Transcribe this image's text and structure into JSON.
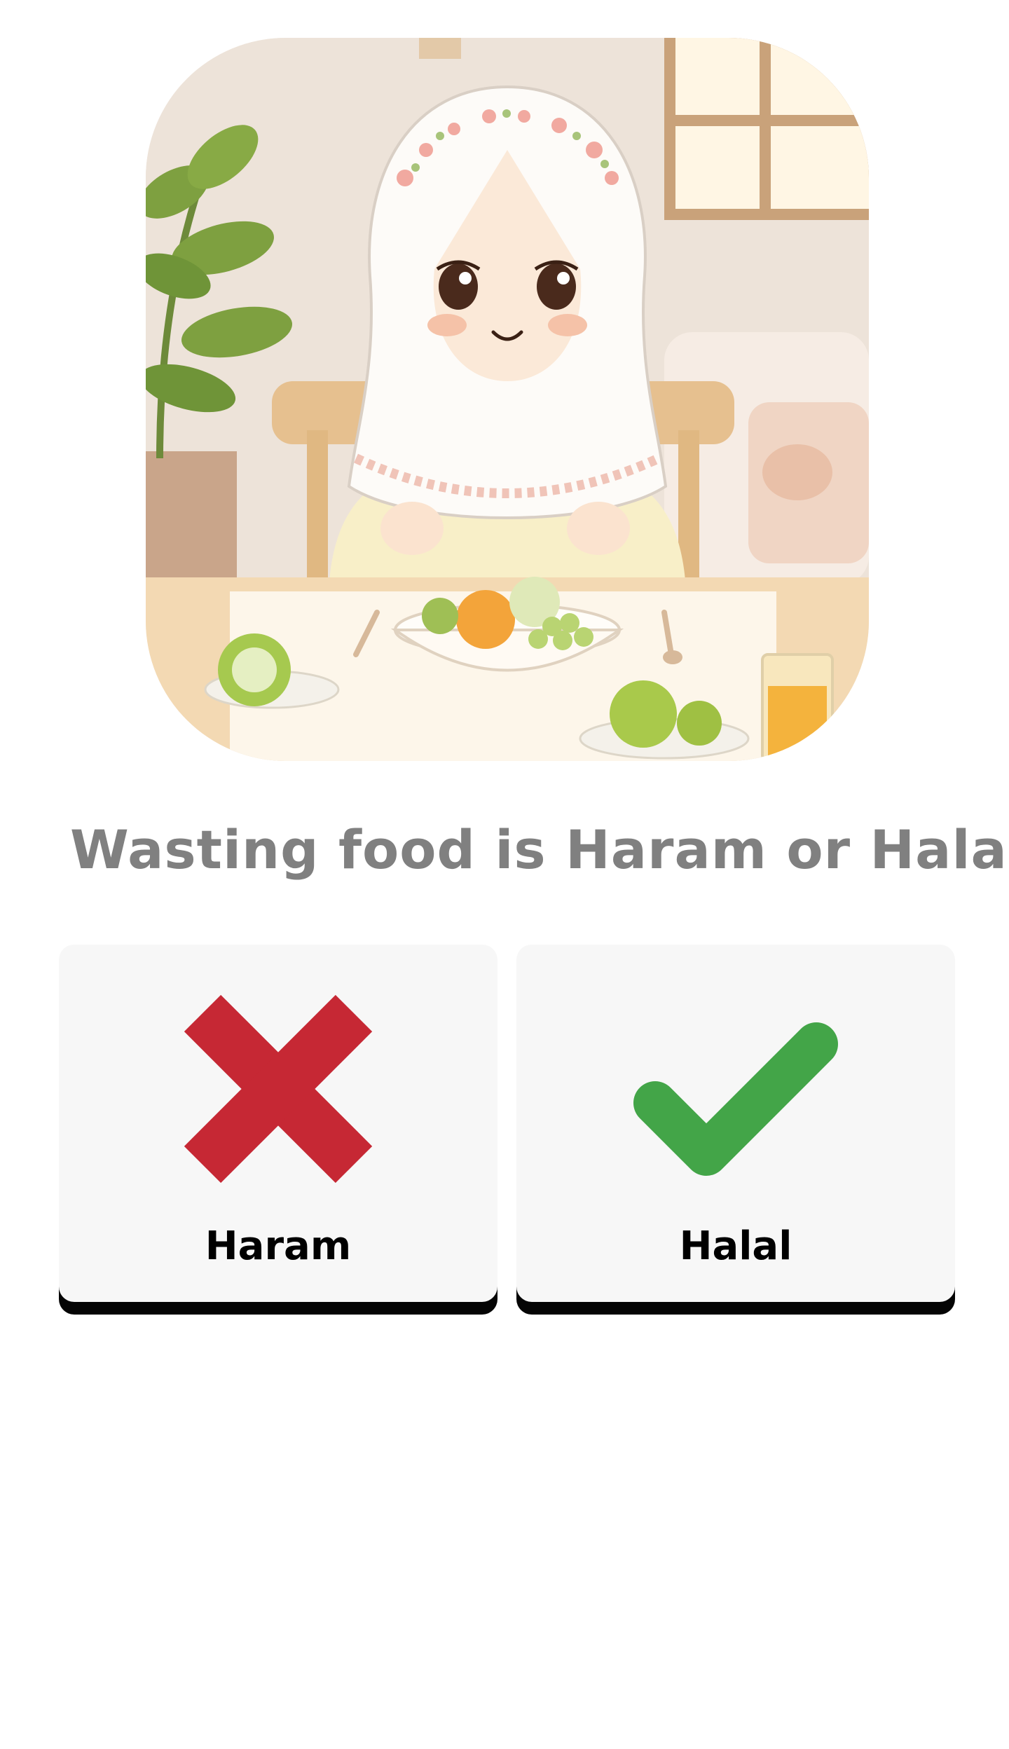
{
  "question": {
    "text": "Wasting food is Haram or Halal"
  },
  "answers": [
    {
      "label": "Haram",
      "icon": "x-mark-icon",
      "color": "#c62834"
    },
    {
      "label": "Halal",
      "icon": "check-mark-icon",
      "color": "#43a548"
    }
  ],
  "colors": {
    "question_text": "#808080",
    "card_background": "#f7f7f7",
    "card_shadow": "#050505"
  }
}
